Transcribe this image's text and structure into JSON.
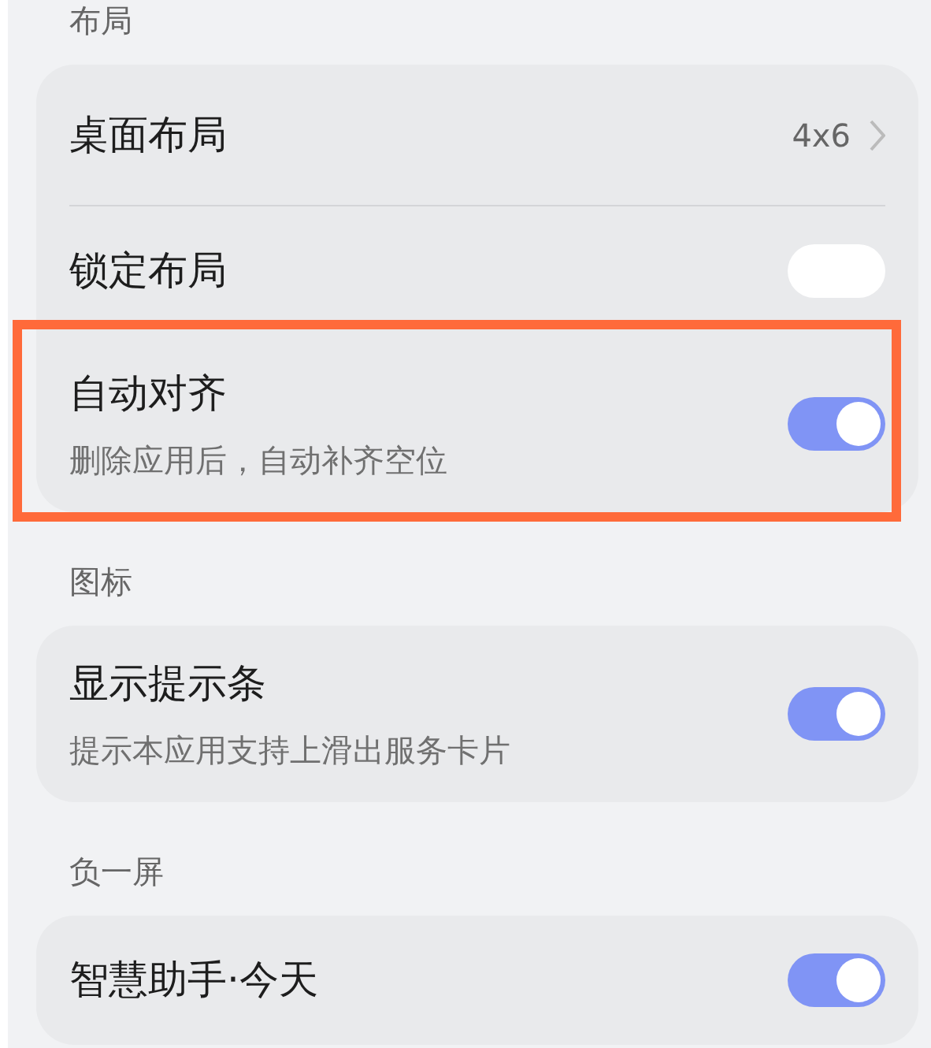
{
  "sections": [
    {
      "header": "布局",
      "rows": [
        {
          "kind": "value",
          "title": "桌面布局",
          "value": "4x6"
        },
        {
          "kind": "toggle",
          "title": "锁定布局",
          "on": false
        },
        {
          "kind": "toggle",
          "title": "自动对齐",
          "subtitle": "删除应用后，自动补齐空位",
          "on": true,
          "highlighted": true
        }
      ]
    },
    {
      "header": "图标",
      "rows": [
        {
          "kind": "toggle",
          "title": "显示提示条",
          "subtitle": "提示本应用支持上滑出服务卡片",
          "on": true
        }
      ]
    },
    {
      "header": "负一屏",
      "rows": [
        {
          "kind": "toggle",
          "title": "智慧助手·今天",
          "on": true
        }
      ]
    }
  ]
}
